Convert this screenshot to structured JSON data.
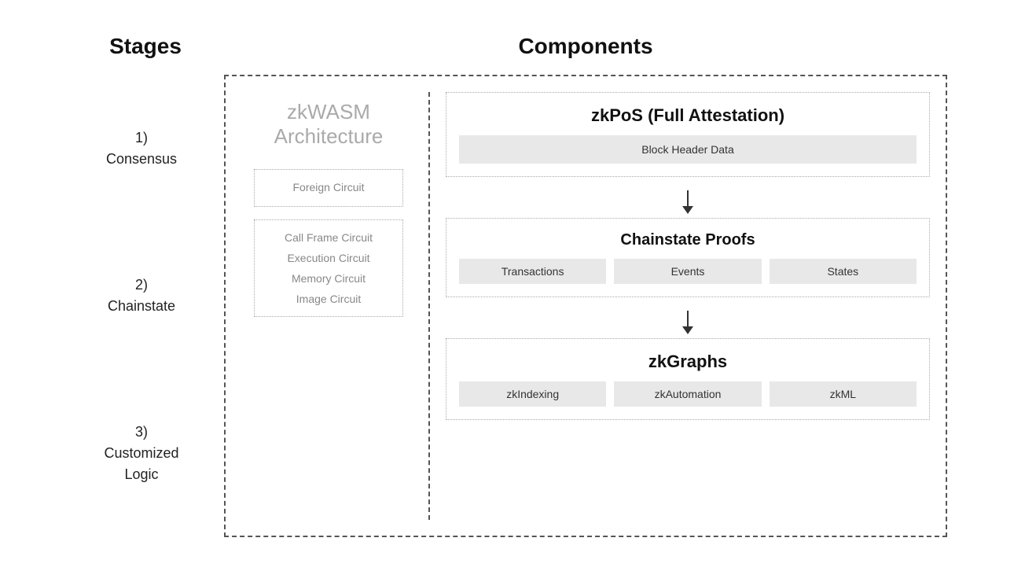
{
  "headers": {
    "stages": "Stages",
    "components": "Components"
  },
  "stages": [
    {
      "id": "stage-1",
      "label": "1)\nConsensus"
    },
    {
      "id": "stage-2",
      "label": "2)\nChainstate"
    },
    {
      "id": "stage-3",
      "label": "3)\nCustomized\nLogic"
    }
  ],
  "zkwasm": {
    "title": "zkWASM\nArchitecture",
    "foreign_circuit": "Foreign Circuit",
    "circuits": [
      "Call Frame Circuit",
      "Execution Circuit",
      "Memory Circuit",
      "Image Circuit"
    ]
  },
  "zkpos": {
    "title": "zkPoS (Full Attestation)",
    "block_header": "Block Header Data"
  },
  "chainstate": {
    "title": "Chainstate Proofs",
    "chips": [
      "Transactions",
      "Events",
      "States"
    ]
  },
  "zkgraphs": {
    "title": "zkGraphs",
    "chips": [
      "zkIndexing",
      "zkAutomation",
      "zkML"
    ]
  }
}
